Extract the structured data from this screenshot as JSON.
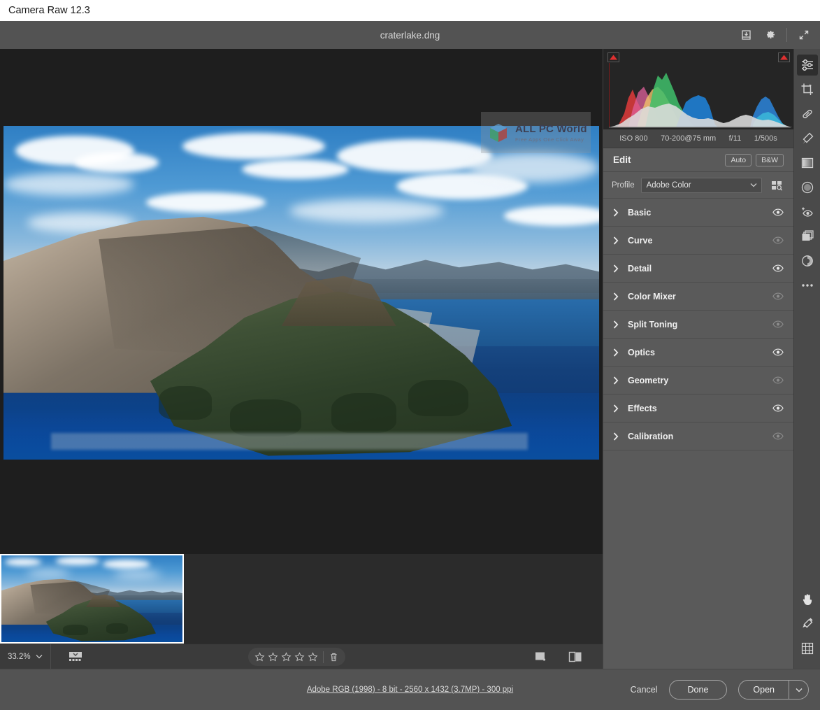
{
  "window": {
    "os_title": "Camera Raw 12.3"
  },
  "topbar": {
    "filename": "craterlake.dng",
    "icons": [
      {
        "name": "save-image-icon",
        "title": "Save Image"
      },
      {
        "name": "preferences-gear-icon",
        "title": "Preferences"
      },
      {
        "name": "fullscreen-expand-icon",
        "title": "Toggle Full Screen"
      }
    ]
  },
  "watermark": {
    "title": "ALL PC World",
    "tagline": "Free Apps One Click Away"
  },
  "histogram": {
    "exif": {
      "iso": "ISO 800",
      "lens": "70-200@75 mm",
      "aperture": "f/11",
      "shutter": "1/500s"
    },
    "shadow_clipping_label": "Shadow clipping warning",
    "highlight_clipping_label": "Highlight clipping warning",
    "clipping_color": "#e03030"
  },
  "edit": {
    "title": "Edit",
    "auto_label": "Auto",
    "bw_label": "B&W",
    "profile_label": "Profile",
    "profile_value": "Adobe Color",
    "profile_browser_title": "Profile Browser",
    "sections": [
      {
        "label": "Basic",
        "visible": true
      },
      {
        "label": "Curve",
        "visible": false
      },
      {
        "label": "Detail",
        "visible": true
      },
      {
        "label": "Color Mixer",
        "visible": false
      },
      {
        "label": "Split Toning",
        "visible": false
      },
      {
        "label": "Optics",
        "visible": true
      },
      {
        "label": "Geometry",
        "visible": false
      },
      {
        "label": "Effects",
        "visible": true
      },
      {
        "label": "Calibration",
        "visible": false
      }
    ]
  },
  "tool_rail": {
    "top_tools": [
      {
        "name": "edit-sliders-icon",
        "title": "Edit",
        "active": true
      },
      {
        "name": "crop-rotate-icon",
        "title": "Crop & Rotate",
        "active": false
      },
      {
        "name": "spot-healing-icon",
        "title": "Healing",
        "active": false
      },
      {
        "name": "adjustment-brush-icon",
        "title": "Adjustment Brush",
        "active": false
      },
      {
        "name": "graduated-filter-icon",
        "title": "Graduated Filter",
        "active": false
      },
      {
        "name": "radial-filter-icon",
        "title": "Radial Filter",
        "active": false
      },
      {
        "name": "red-eye-icon",
        "title": "Red Eye",
        "active": false
      },
      {
        "name": "presets-icon",
        "title": "Presets",
        "active": false
      },
      {
        "name": "snapshots-icon",
        "title": "Snapshots",
        "active": false
      },
      {
        "name": "more-options-icon",
        "title": "More Image Settings",
        "active": false
      }
    ],
    "bottom_tools": [
      {
        "name": "hand-tool-icon",
        "title": "Hand Tool"
      },
      {
        "name": "white-balance-eyedropper-icon",
        "title": "White Balance Tool"
      },
      {
        "name": "grid-overlay-icon",
        "title": "Toggle Grid Overlay"
      }
    ]
  },
  "filmstrip": {
    "zoom_level": "33.2%",
    "zoom_dropdown_title": "Zoom Level",
    "filmstrip_toggle_title": "Toggle Filmstrip",
    "rating_stars": 5,
    "rating_value": 0,
    "delete_title": "Mark for Delete",
    "view_single_title": "Single View",
    "view_beforeafter_title": "Before / After Left Right"
  },
  "bottombar": {
    "workflow_options": "Adobe RGB (1998) - 8 bit - 2560 x 1432 (3.7MP) - 300 ppi",
    "cancel_label": "Cancel",
    "done_label": "Done",
    "open_label": "Open",
    "open_menu_title": "Open Options"
  }
}
